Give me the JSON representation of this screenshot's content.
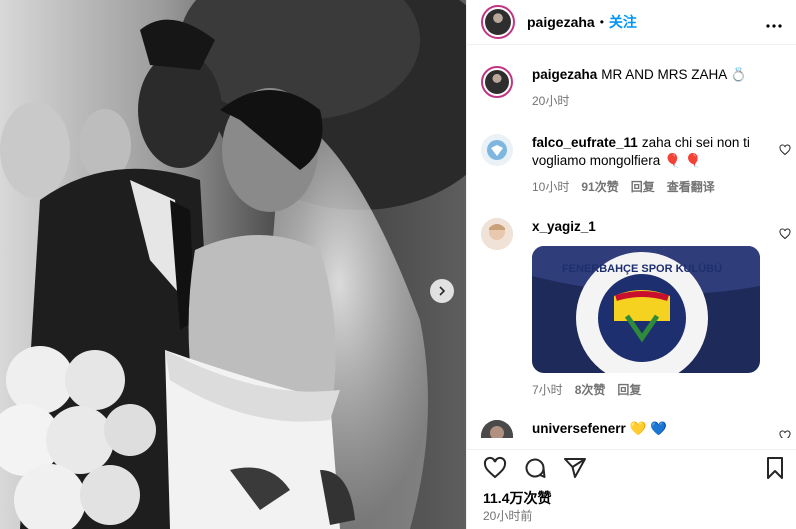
{
  "post": {
    "username": "paigezaha",
    "follow_label": "关注",
    "dot": "•",
    "more_icon": "more-horizontal-icon"
  },
  "caption": {
    "username": "paigezaha",
    "text": "MR AND MRS ZAHA 💍",
    "time": "20小时"
  },
  "comments": [
    {
      "username": "falco_eufrate_11",
      "text": "zaha chi sei non ti vogliamo mongolfiera 🎈 🎈",
      "time": "10小时",
      "likes": "91次赞",
      "reply": "回复",
      "translate": "查看翻译"
    },
    {
      "username": "x_yagiz_1",
      "text": "",
      "time": "7小时",
      "likes": "8次赞",
      "reply": "回复",
      "gif_text": "FENERBAHÇE SPOR KULÜBÜ"
    },
    {
      "username": "universefenerr",
      "text": "💛 💙"
    }
  ],
  "footer": {
    "likes": "11.4万次赞",
    "time": "20小时前"
  },
  "colors": {
    "accent": "#0095f6",
    "meta_gray": "#737373",
    "ring": "#c13584"
  }
}
